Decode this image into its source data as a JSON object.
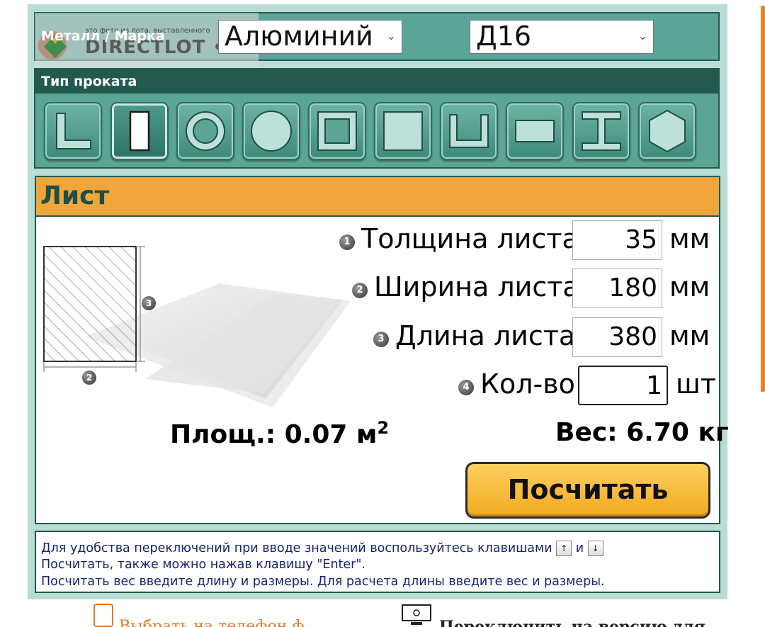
{
  "watermark": {
    "small_text": "это фото из лота, выставленного",
    "brand": "DIRECTLOT • RU"
  },
  "metal": {
    "label": "Металл / Марка",
    "selected_metal": "Алюминий",
    "selected_grade": "Д16"
  },
  "profile_types": {
    "title": "Тип проката",
    "selected_index": 1,
    "items": [
      {
        "icon": "angle-profile-icon"
      },
      {
        "icon": "sheet-profile-icon"
      },
      {
        "icon": "pipe-profile-icon"
      },
      {
        "icon": "round-bar-profile-icon"
      },
      {
        "icon": "square-tube-profile-icon"
      },
      {
        "icon": "square-bar-profile-icon"
      },
      {
        "icon": "channel-profile-icon"
      },
      {
        "icon": "flat-bar-profile-icon"
      },
      {
        "icon": "i-beam-profile-icon"
      },
      {
        "icon": "hexagon-profile-icon"
      }
    ]
  },
  "calc": {
    "title": "Лист",
    "fields": [
      {
        "badge": "1",
        "label": "Толщина листа",
        "value": "35",
        "unit": "мм"
      },
      {
        "badge": "2",
        "label": "Ширина листа",
        "value": "180",
        "unit": "мм"
      },
      {
        "badge": "3",
        "label": "Длина листа",
        "value": "380",
        "unit": "мм"
      },
      {
        "badge": "4",
        "label": "Кол-во",
        "value": "1",
        "unit": "шт"
      }
    ],
    "diagram_badges": {
      "length": "3",
      "width": "2"
    },
    "area_label": "Площ.: 0.07 м",
    "area_sup": "2",
    "weight_label": "Вес: 6.70 кг",
    "button_label": "Посчитать"
  },
  "help": {
    "line1_pre": "Для удобства переключений при вводе значений воспользуйтесь клавишами",
    "line1_and": "и",
    "key_up": "↑",
    "key_down": "↓",
    "line2": "Посчитать, также можно нажав клавишу \"Enter\".",
    "line3": "Посчитать вес введите длину и размеры. Для расчета длины введите вес и размеры."
  },
  "footer": {
    "left_text": "Выбрать на телефон ф",
    "right_text": "Переключить на версию для"
  },
  "colors": {
    "teal": "#5aa596",
    "dark_teal": "#235a4d",
    "orange": "#f1a53b",
    "help_text": "#13247a"
  }
}
